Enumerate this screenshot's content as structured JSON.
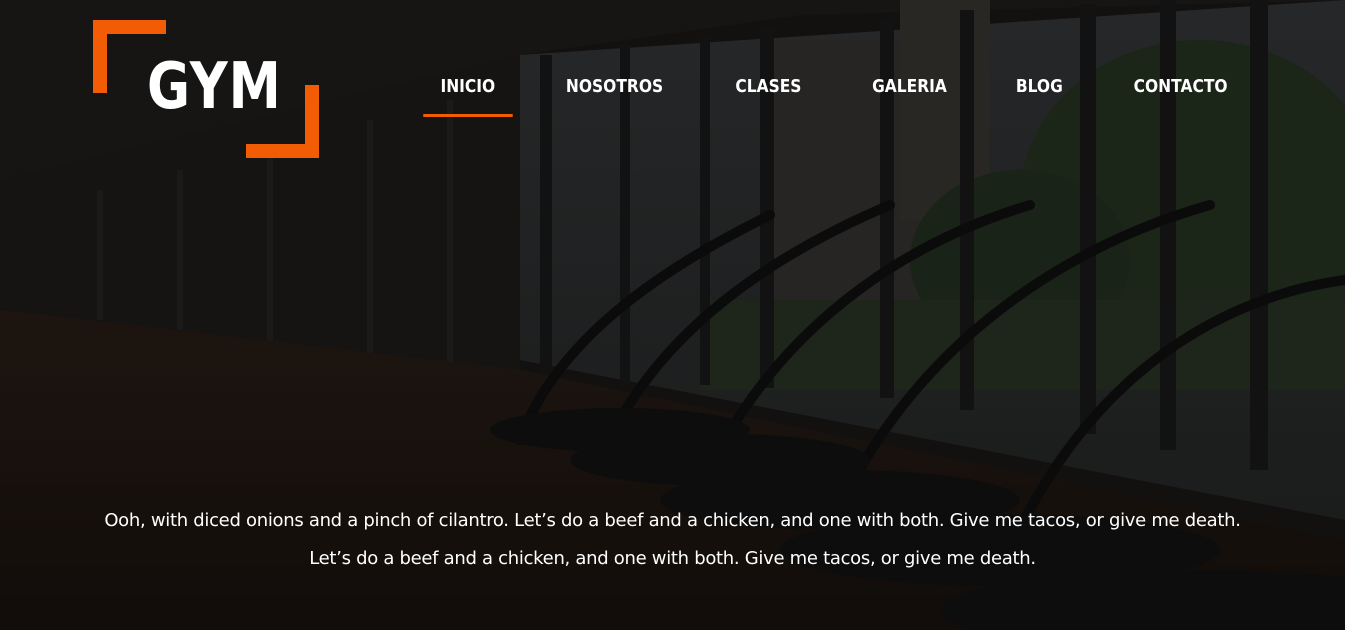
{
  "brand": {
    "logo_text": "GYM",
    "accent_color": "#f25c05"
  },
  "nav": {
    "items": [
      {
        "label": "INICIO",
        "active": true
      },
      {
        "label": "NOSOTROS",
        "active": false
      },
      {
        "label": "CLASES",
        "active": false
      },
      {
        "label": "GALERIA",
        "active": false
      },
      {
        "label": "BLOG",
        "active": false
      },
      {
        "label": "CONTACTO",
        "active": false
      }
    ]
  },
  "hero": {
    "line1": "Ooh, with diced onions and a pinch of cilantro. Let’s do a beef and a chicken, and one with both. Give me tacos, or give me death.",
    "line2": "Let’s do a beef and a chicken, and one with both. Give me tacos, or give me death."
  }
}
